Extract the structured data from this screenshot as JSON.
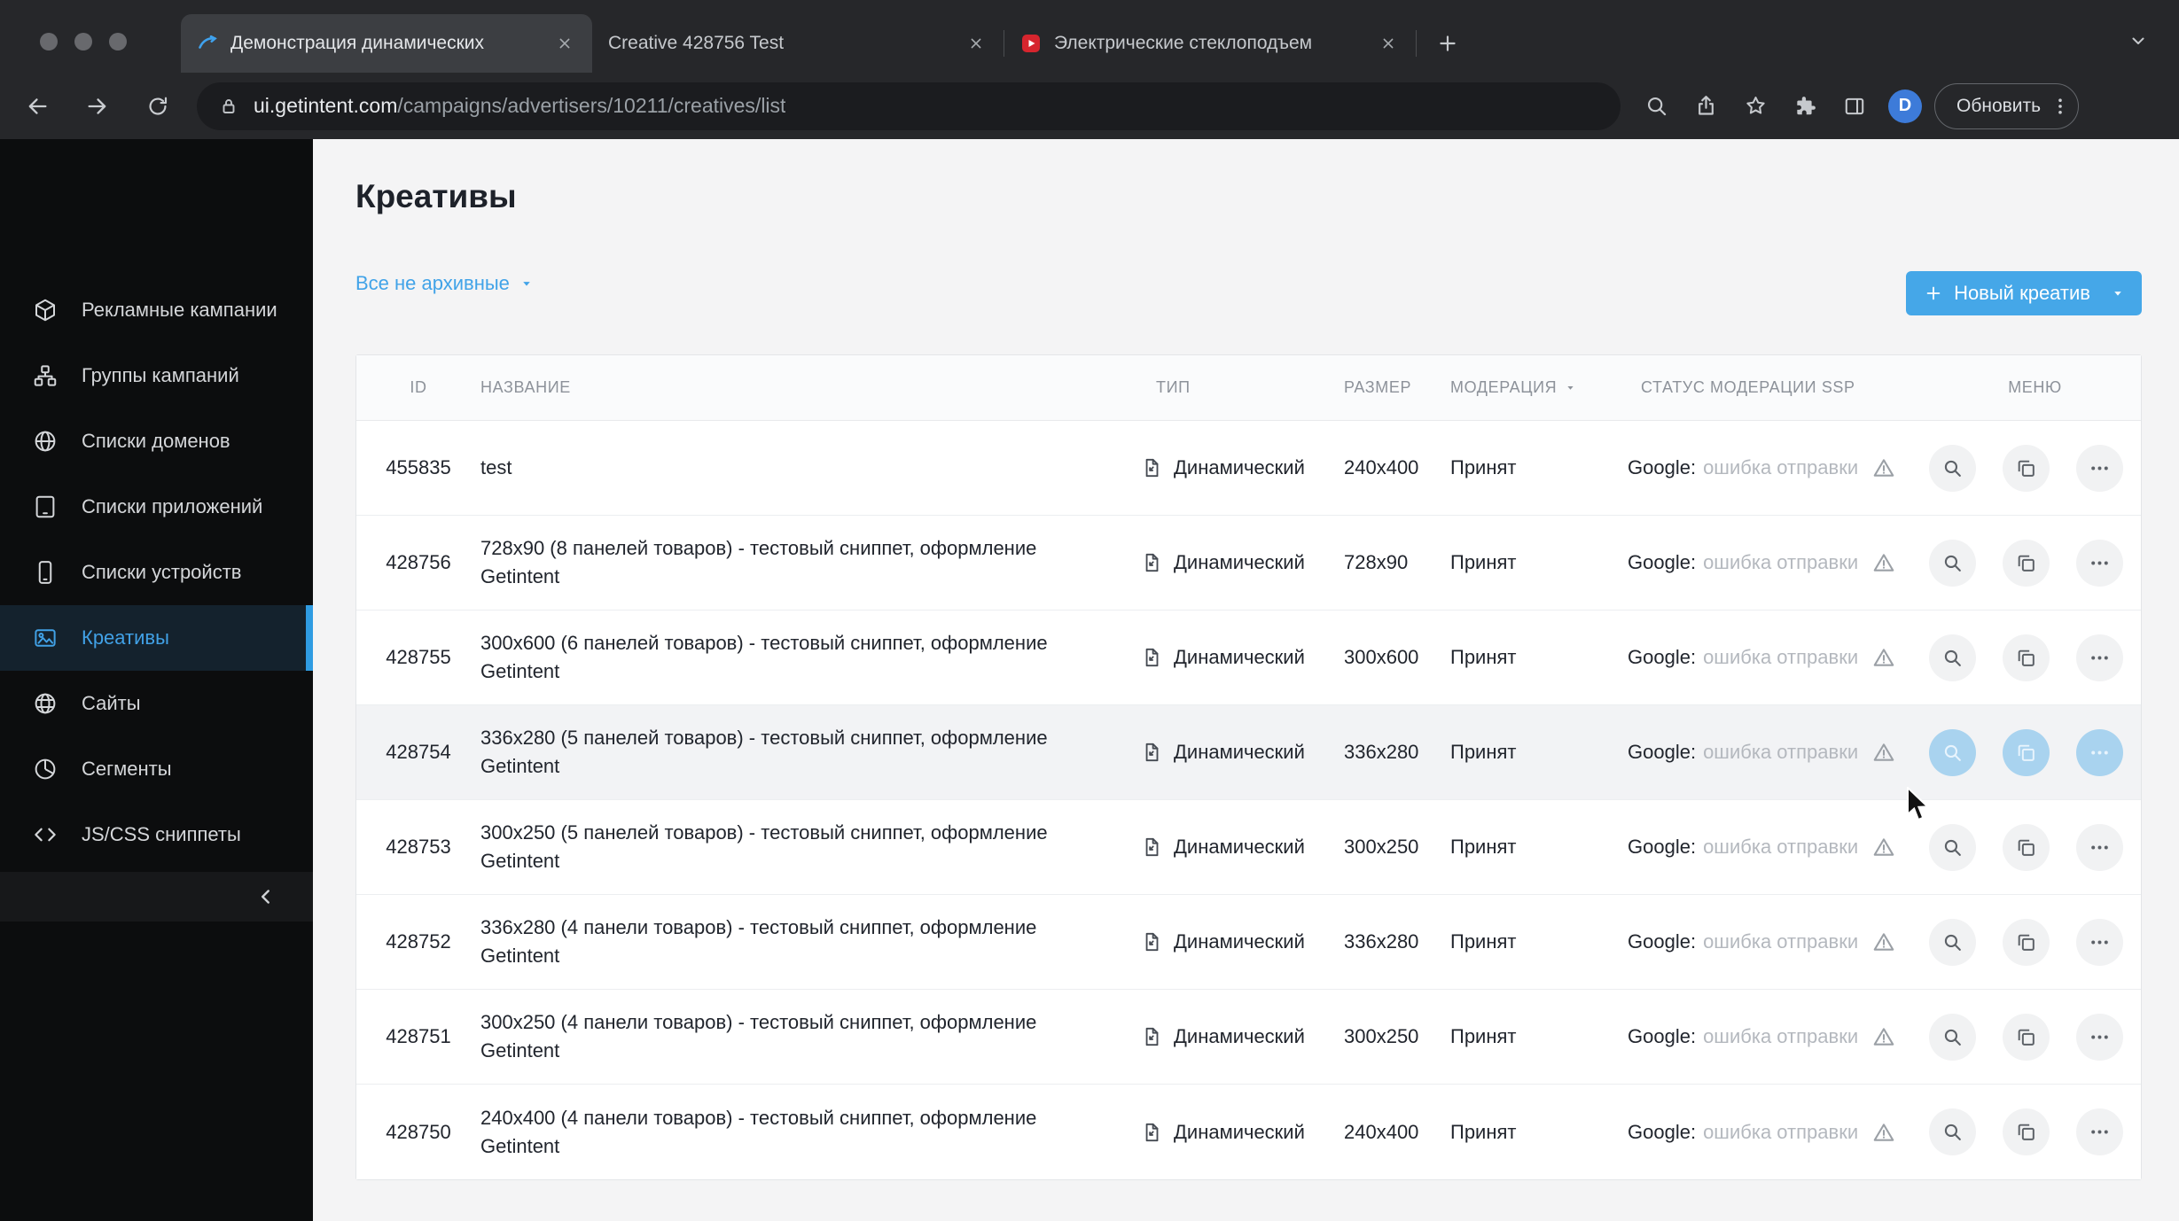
{
  "browser": {
    "tabs": [
      {
        "title": "Демонстрация динамических",
        "active": true
      },
      {
        "title": "Creative 428756 Test",
        "active": false
      },
      {
        "title": "Электрические стеклоподъем",
        "active": false
      }
    ],
    "url_domain": "ui.getintent.com",
    "url_path": "/campaigns/advertisers/10211/creatives/list",
    "update_button_label": "Обновить",
    "avatar_letter": "D"
  },
  "sidebar": {
    "items": [
      {
        "label": "Рекламные кампании",
        "icon": "campaigns-cube-icon",
        "active": false
      },
      {
        "label": "Группы кампаний",
        "icon": "campaign-groups-icon",
        "active": false
      },
      {
        "label": "Списки доменов",
        "icon": "domain-lists-icon",
        "active": false
      },
      {
        "label": "Списки приложений",
        "icon": "app-lists-icon",
        "active": false
      },
      {
        "label": "Списки устройств",
        "icon": "device-lists-icon",
        "active": false
      },
      {
        "label": "Креативы",
        "icon": "creatives-icon",
        "active": true
      },
      {
        "label": "Сайты",
        "icon": "sites-icon",
        "active": false
      },
      {
        "label": "Сегменты",
        "icon": "segments-icon",
        "active": false
      },
      {
        "label": "JS/CSS сниппеты",
        "icon": "snippets-icon",
        "active": false
      }
    ]
  },
  "page": {
    "title": "Креативы",
    "filter_label": "Все не архивные",
    "new_creative_button": "Новый креатив"
  },
  "table": {
    "columns": [
      "ID",
      "НАЗВАНИЕ",
      "ТИП",
      "РАЗМЕР",
      "МОДЕРАЦИЯ",
      "СТАТУС МОДЕРАЦИИ SSP",
      "МЕНЮ"
    ],
    "rows": [
      {
        "id": "455835",
        "name": "test",
        "type": "Динамический",
        "size": "240x400",
        "moderation": "Принят",
        "ssp_provider": "Google:",
        "ssp_status": "ошибка отправки"
      },
      {
        "id": "428756",
        "name": "728x90 (8 панелей товаров) - тестовый сниппет, оформление Getintent",
        "type": "Динамический",
        "size": "728x90",
        "moderation": "Принят",
        "ssp_provider": "Google:",
        "ssp_status": "ошибка отправки"
      },
      {
        "id": "428755",
        "name": "300x600 (6 панелей товаров) - тестовый сниппет, оформление Getintent",
        "type": "Динамический",
        "size": "300x600",
        "moderation": "Принят",
        "ssp_provider": "Google:",
        "ssp_status": "ошибка отправки"
      },
      {
        "id": "428754",
        "name": "336x280 (5 панелей товаров) - тестовый сниппет, оформление Getintent",
        "type": "Динамический",
        "size": "336x280",
        "moderation": "Принят",
        "ssp_provider": "Google:",
        "ssp_status": "ошибка отправки"
      },
      {
        "id": "428753",
        "name": "300x250 (5 панелей товаров) - тестовый сниппет, оформление Getintent",
        "type": "Динамический",
        "size": "300x250",
        "moderation": "Принят",
        "ssp_provider": "Google:",
        "ssp_status": "ошибка отправки"
      },
      {
        "id": "428752",
        "name": "336x280 (4 панели товаров) - тестовый сниппет, оформление Getintent",
        "type": "Динамический",
        "size": "336x280",
        "moderation": "Принят",
        "ssp_provider": "Google:",
        "ssp_status": "ошибка отправки"
      },
      {
        "id": "428751",
        "name": "300x250 (4 панели товаров) - тестовый сниппет, оформление Getintent",
        "type": "Динамический",
        "size": "300x250",
        "moderation": "Принят",
        "ssp_provider": "Google:",
        "ssp_status": "ошибка отправки"
      },
      {
        "id": "428750",
        "name": "240x400 (4 панели товаров) - тестовый сниппет, оформление Getintent",
        "type": "Динамический",
        "size": "240x400",
        "moderation": "Принят",
        "ssp_provider": "Google:",
        "ssp_status": "ошибка отправки"
      }
    ]
  },
  "colors": {
    "accent_blue": "#45a7e8",
    "link_blue": "#41a3e8",
    "sidebar_active_blue": "#2f9ce2",
    "status_muted_gray": "#b4b8be",
    "avatar_blue": "#3d7bd9",
    "tab_favicon_red": "#d6252e"
  }
}
